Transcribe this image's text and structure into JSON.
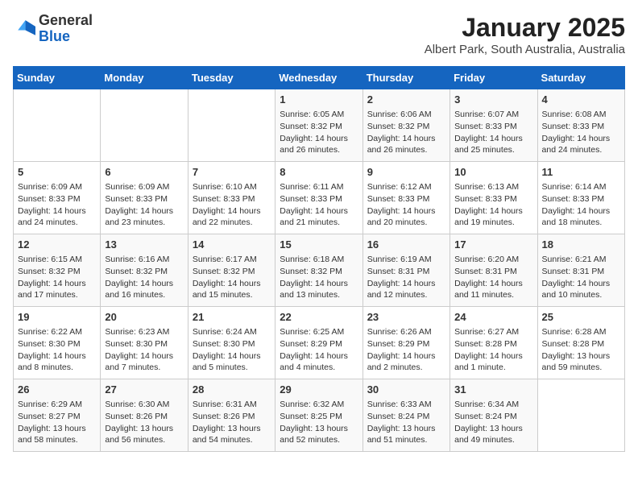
{
  "logo": {
    "general": "General",
    "blue": "Blue"
  },
  "title": "January 2025",
  "subtitle": "Albert Park, South Australia, Australia",
  "days_of_week": [
    "Sunday",
    "Monday",
    "Tuesday",
    "Wednesday",
    "Thursday",
    "Friday",
    "Saturday"
  ],
  "weeks": [
    [
      {
        "day": null
      },
      {
        "day": null
      },
      {
        "day": null
      },
      {
        "day": 1,
        "sunrise": "6:05 AM",
        "sunset": "8:32 PM",
        "daylight": "14 hours and 26 minutes."
      },
      {
        "day": 2,
        "sunrise": "6:06 AM",
        "sunset": "8:32 PM",
        "daylight": "14 hours and 26 minutes."
      },
      {
        "day": 3,
        "sunrise": "6:07 AM",
        "sunset": "8:33 PM",
        "daylight": "14 hours and 25 minutes."
      },
      {
        "day": 4,
        "sunrise": "6:08 AM",
        "sunset": "8:33 PM",
        "daylight": "14 hours and 24 minutes."
      }
    ],
    [
      {
        "day": 5,
        "sunrise": "6:09 AM",
        "sunset": "8:33 PM",
        "daylight": "14 hours and 24 minutes."
      },
      {
        "day": 6,
        "sunrise": "6:09 AM",
        "sunset": "8:33 PM",
        "daylight": "14 hours and 23 minutes."
      },
      {
        "day": 7,
        "sunrise": "6:10 AM",
        "sunset": "8:33 PM",
        "daylight": "14 hours and 22 minutes."
      },
      {
        "day": 8,
        "sunrise": "6:11 AM",
        "sunset": "8:33 PM",
        "daylight": "14 hours and 21 minutes."
      },
      {
        "day": 9,
        "sunrise": "6:12 AM",
        "sunset": "8:33 PM",
        "daylight": "14 hours and 20 minutes."
      },
      {
        "day": 10,
        "sunrise": "6:13 AM",
        "sunset": "8:33 PM",
        "daylight": "14 hours and 19 minutes."
      },
      {
        "day": 11,
        "sunrise": "6:14 AM",
        "sunset": "8:33 PM",
        "daylight": "14 hours and 18 minutes."
      }
    ],
    [
      {
        "day": 12,
        "sunrise": "6:15 AM",
        "sunset": "8:32 PM",
        "daylight": "14 hours and 17 minutes."
      },
      {
        "day": 13,
        "sunrise": "6:16 AM",
        "sunset": "8:32 PM",
        "daylight": "14 hours and 16 minutes."
      },
      {
        "day": 14,
        "sunrise": "6:17 AM",
        "sunset": "8:32 PM",
        "daylight": "14 hours and 15 minutes."
      },
      {
        "day": 15,
        "sunrise": "6:18 AM",
        "sunset": "8:32 PM",
        "daylight": "14 hours and 13 minutes."
      },
      {
        "day": 16,
        "sunrise": "6:19 AM",
        "sunset": "8:31 PM",
        "daylight": "14 hours and 12 minutes."
      },
      {
        "day": 17,
        "sunrise": "6:20 AM",
        "sunset": "8:31 PM",
        "daylight": "14 hours and 11 minutes."
      },
      {
        "day": 18,
        "sunrise": "6:21 AM",
        "sunset": "8:31 PM",
        "daylight": "14 hours and 10 minutes."
      }
    ],
    [
      {
        "day": 19,
        "sunrise": "6:22 AM",
        "sunset": "8:30 PM",
        "daylight": "14 hours and 8 minutes."
      },
      {
        "day": 20,
        "sunrise": "6:23 AM",
        "sunset": "8:30 PM",
        "daylight": "14 hours and 7 minutes."
      },
      {
        "day": 21,
        "sunrise": "6:24 AM",
        "sunset": "8:30 PM",
        "daylight": "14 hours and 5 minutes."
      },
      {
        "day": 22,
        "sunrise": "6:25 AM",
        "sunset": "8:29 PM",
        "daylight": "14 hours and 4 minutes."
      },
      {
        "day": 23,
        "sunrise": "6:26 AM",
        "sunset": "8:29 PM",
        "daylight": "14 hours and 2 minutes."
      },
      {
        "day": 24,
        "sunrise": "6:27 AM",
        "sunset": "8:28 PM",
        "daylight": "14 hours and 1 minute."
      },
      {
        "day": 25,
        "sunrise": "6:28 AM",
        "sunset": "8:28 PM",
        "daylight": "13 hours and 59 minutes."
      }
    ],
    [
      {
        "day": 26,
        "sunrise": "6:29 AM",
        "sunset": "8:27 PM",
        "daylight": "13 hours and 58 minutes."
      },
      {
        "day": 27,
        "sunrise": "6:30 AM",
        "sunset": "8:26 PM",
        "daylight": "13 hours and 56 minutes."
      },
      {
        "day": 28,
        "sunrise": "6:31 AM",
        "sunset": "8:26 PM",
        "daylight": "13 hours and 54 minutes."
      },
      {
        "day": 29,
        "sunrise": "6:32 AM",
        "sunset": "8:25 PM",
        "daylight": "13 hours and 52 minutes."
      },
      {
        "day": 30,
        "sunrise": "6:33 AM",
        "sunset": "8:24 PM",
        "daylight": "13 hours and 51 minutes."
      },
      {
        "day": 31,
        "sunrise": "6:34 AM",
        "sunset": "8:24 PM",
        "daylight": "13 hours and 49 minutes."
      },
      {
        "day": null
      }
    ]
  ],
  "labels": {
    "sunrise_prefix": "Sunrise: ",
    "sunset_prefix": "Sunset: ",
    "daylight_prefix": "Daylight: "
  }
}
